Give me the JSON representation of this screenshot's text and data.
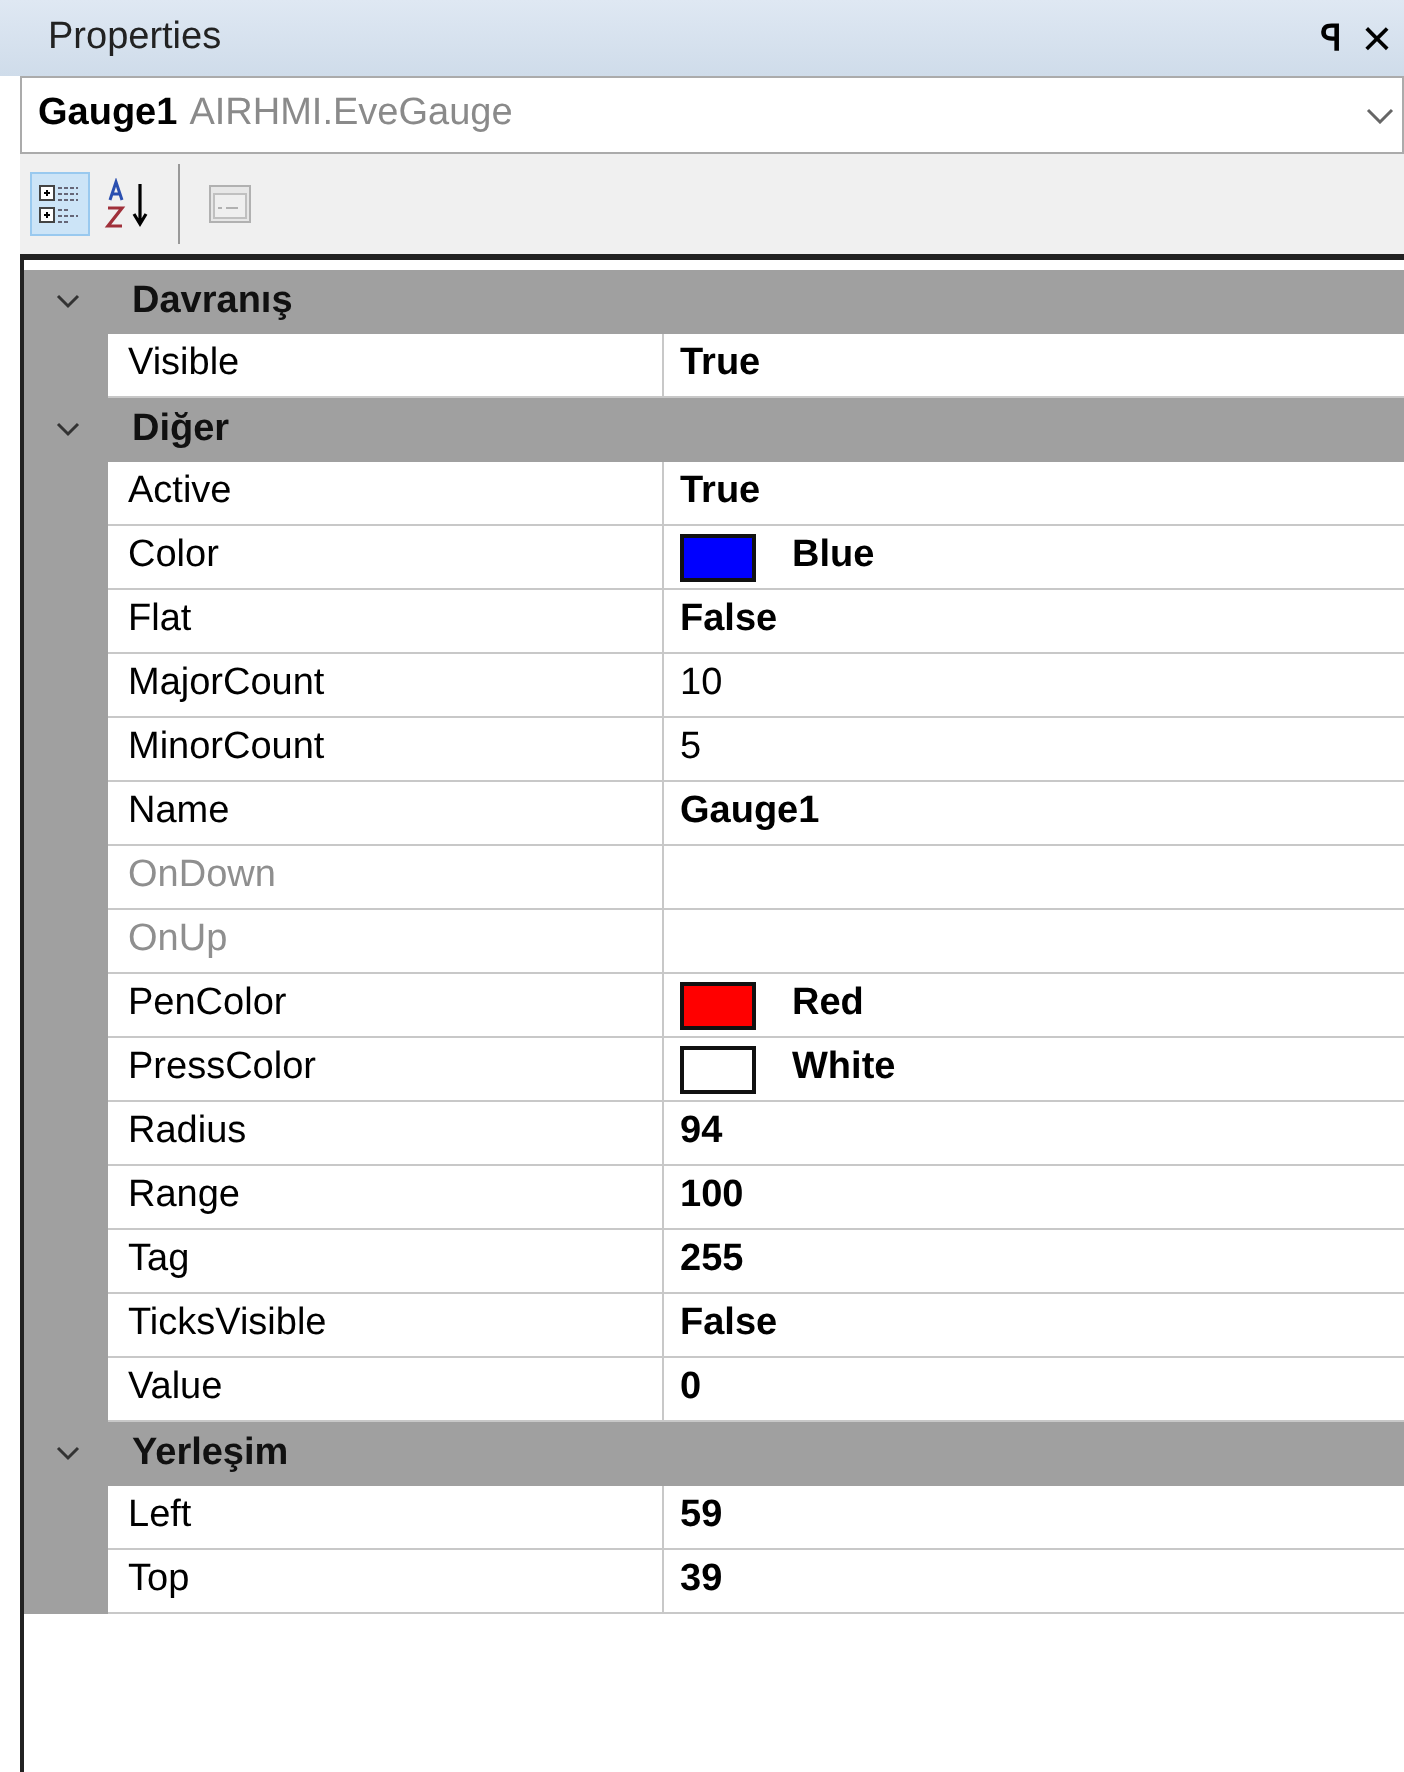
{
  "panel": {
    "title": "Properties",
    "pin": "ꟼ",
    "close": "×"
  },
  "object_selector": {
    "name": "Gauge1",
    "type": "AIRHMI.EveGauge"
  },
  "toolbar": [
    {
      "kind": "categorized",
      "selected": true
    },
    {
      "kind": "alphabetical",
      "selected": false
    },
    {
      "kind": "separator"
    },
    {
      "kind": "pages",
      "selected": false,
      "disabled": true
    }
  ],
  "categories": [
    {
      "name": "Davranış",
      "expanded": true,
      "properties": [
        {
          "name": "Visible",
          "value": "True",
          "bold": true,
          "disabled": false
        }
      ]
    },
    {
      "name": "Diğer",
      "expanded": true,
      "properties": [
        {
          "name": "Active",
          "value": "True",
          "bold": true,
          "disabled": false
        },
        {
          "name": "Color",
          "value": "Blue",
          "bold": true,
          "disabled": false,
          "color": "#0000ff"
        },
        {
          "name": "Flat",
          "value": "False",
          "bold": true,
          "disabled": false
        },
        {
          "name": "MajorCount",
          "value": "10",
          "bold": false,
          "disabled": false
        },
        {
          "name": "MinorCount",
          "value": "5",
          "bold": false,
          "disabled": false
        },
        {
          "name": "Name",
          "value": "Gauge1",
          "bold": true,
          "disabled": false
        },
        {
          "name": "OnDown",
          "disabled": true
        },
        {
          "name": "OnUp",
          "disabled": true
        },
        {
          "name": "PenColor",
          "value": "Red",
          "bold": true,
          "disabled": false,
          "color": "#ff0000"
        },
        {
          "name": "PressColor",
          "value": "White",
          "bold": true,
          "disabled": false,
          "color": "#ffffff"
        },
        {
          "name": "Radius",
          "value": "94",
          "bold": true,
          "disabled": false
        },
        {
          "name": "Range",
          "value": "100",
          "bold": true,
          "disabled": false
        },
        {
          "name": "Tag",
          "value": "255",
          "bold": true,
          "disabled": false
        },
        {
          "name": "TicksVisible",
          "value": "False",
          "bold": true,
          "disabled": false
        },
        {
          "name": "Value",
          "value": "0",
          "bold": true,
          "disabled": false
        }
      ]
    },
    {
      "name": "Yerleşim",
      "expanded": true,
      "properties": [
        {
          "name": "Left",
          "value": "59",
          "bold": true,
          "disabled": false
        },
        {
          "name": "Top",
          "value": "39",
          "bold": true,
          "disabled": false
        }
      ]
    }
  ]
}
